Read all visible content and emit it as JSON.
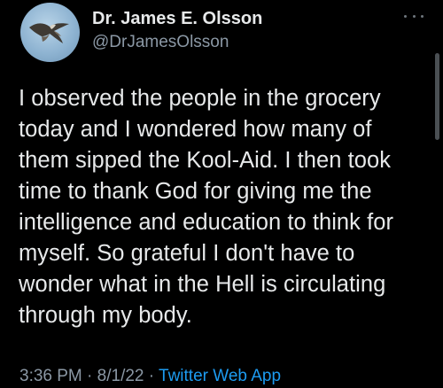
{
  "user": {
    "name": "Dr. James E. Olsson",
    "handle": "@DrJamesOlsson"
  },
  "tweet": {
    "lines": [
      "I observed the people in the grocery",
      "today and I wondered how many of",
      "them sipped the Kool-Aid. I then took",
      "time to thank God for giving me the",
      "intelligence and education to think for",
      "myself. So grateful I don't have to",
      "wonder what in the Hell is circulating",
      "through my body."
    ]
  },
  "meta": {
    "time": "3:36 PM",
    "date": "8/1/22",
    "separator": "·",
    "source": "Twitter Web App"
  },
  "icons": {
    "avatar": "bird-of-prey-avatar",
    "more": "more-options-icon"
  },
  "colors": {
    "background": "#000000",
    "text": "#e7e9ea",
    "secondary": "#8b98a5",
    "accent": "#1d9bf0"
  }
}
